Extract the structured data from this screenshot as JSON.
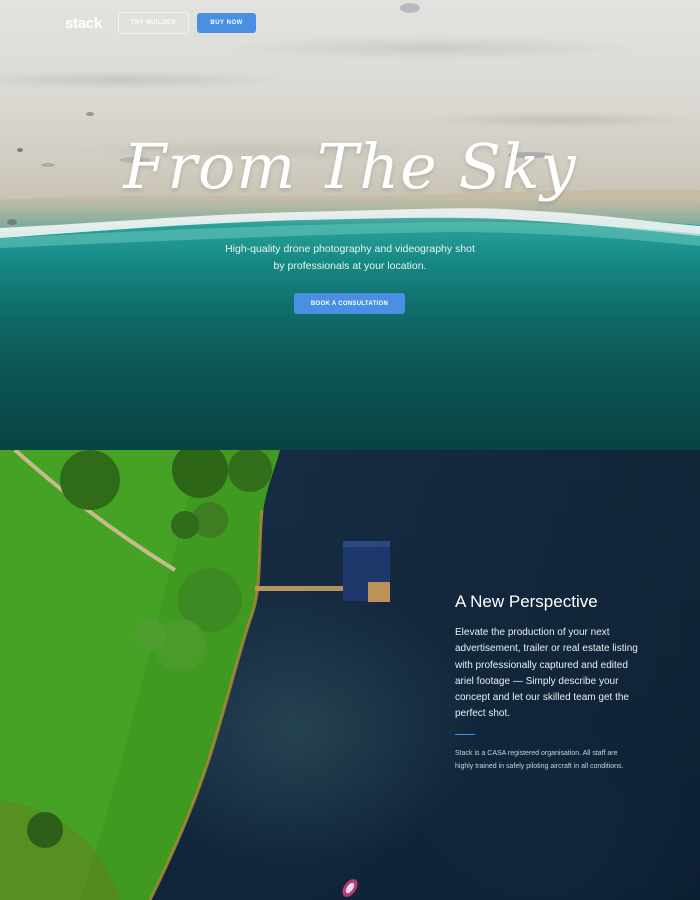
{
  "nav": {
    "logo": "stack",
    "try_builder": "TRY BUILDER",
    "buy_now": "BUY NOW"
  },
  "hero": {
    "title": "From The Sky",
    "subtitle": "High-quality drone photography and videography shot by professionals at your location.",
    "cta": "BOOK A CONSULTATION"
  },
  "perspective": {
    "title": "A New Perspective",
    "body": "Elevate the production of your next advertisement, trailer or real estate listing with professionally captured and edited ariel footage — Simply describe your concept and let our skilled team get the perfect shot.",
    "note": "Stack is a CASA registered organisation. All staff are highly trained in safely piloting aircraft in all conditions."
  },
  "colors": {
    "accent": "#4a90e2",
    "ocean": "#0f6f6c",
    "lake": "#13283a",
    "grass": "#3a8f1e"
  }
}
